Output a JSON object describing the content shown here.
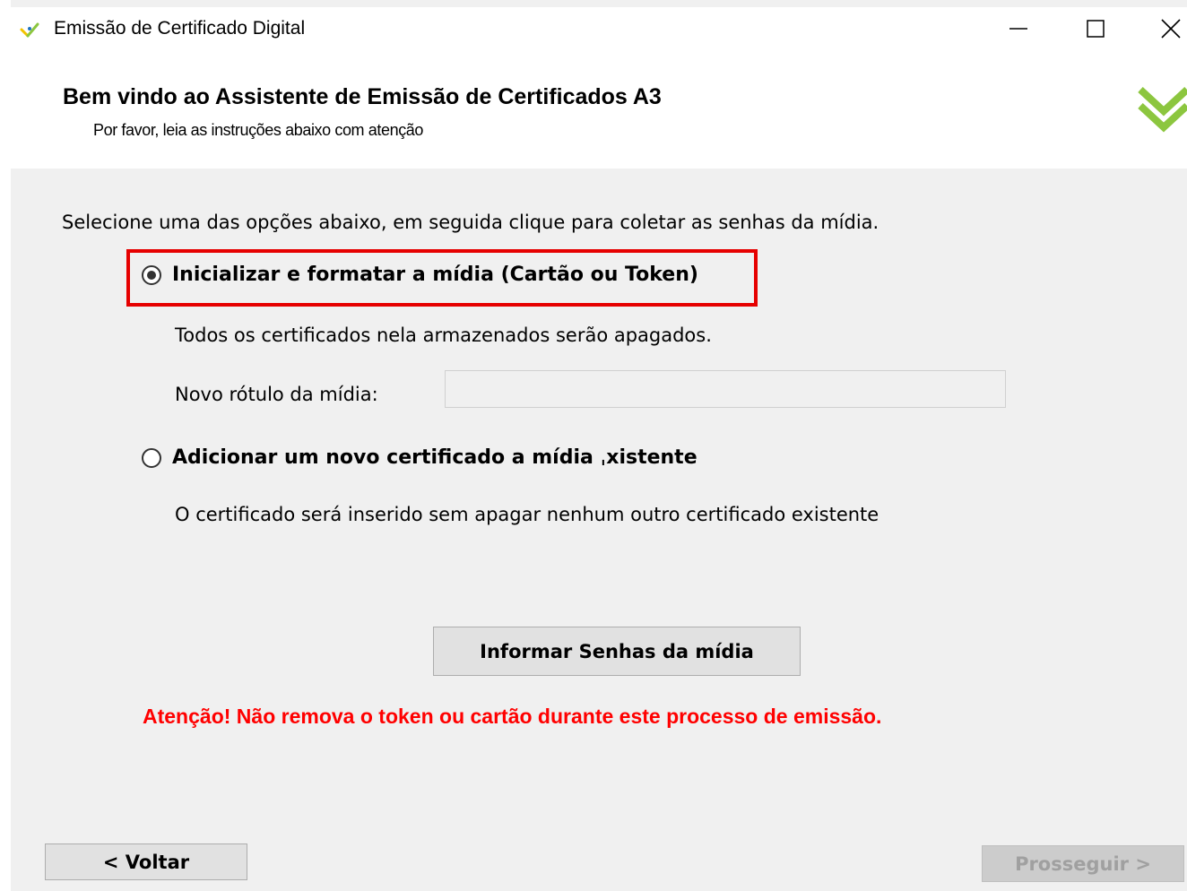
{
  "window": {
    "title": "Emissão de Certificado Digital",
    "app_icon": "checkmark-logo-icon",
    "controls": [
      "minimize-icon",
      "maximize-icon",
      "close-icon"
    ]
  },
  "header": {
    "title": "Bem vindo ao Assistente de Emissão de Certificados A3",
    "subtitle": "Por favor, leia as instruções abaixo com atenção",
    "logo_icon": "double-chevron-logo-icon"
  },
  "main": {
    "instruction": "Selecione uma das opções abaixo, em seguida clique para coletar as senhas da mídia.",
    "option1": {
      "label": "Inicializar e formatar a mídia (Cartão ou Token)",
      "selected": true,
      "description": "Todos os certificados nela armazenados serão apagados.",
      "field_label": "Novo rótulo da mídia:",
      "field_value": ""
    },
    "option2": {
      "label": "Adicionar um novo certificado a mídia ˌxistente",
      "selected": false,
      "description": "O certificado será inserido sem apagar nenhum outro certificado existente"
    },
    "passwords_button": "Informar Senhas da mídia",
    "warning": "Atenção! Não remova o token ou cartão durante este processo de emissão."
  },
  "footer": {
    "back_button": "< Voltar",
    "next_button": "Prosseguir >",
    "next_enabled": false
  },
  "colors": {
    "highlight_border": "#e60000",
    "warning_text": "#ff0000",
    "logo_green": "#8cc63f",
    "logo_yellow": "#f2c300",
    "logo_blue": "#1e73be"
  }
}
